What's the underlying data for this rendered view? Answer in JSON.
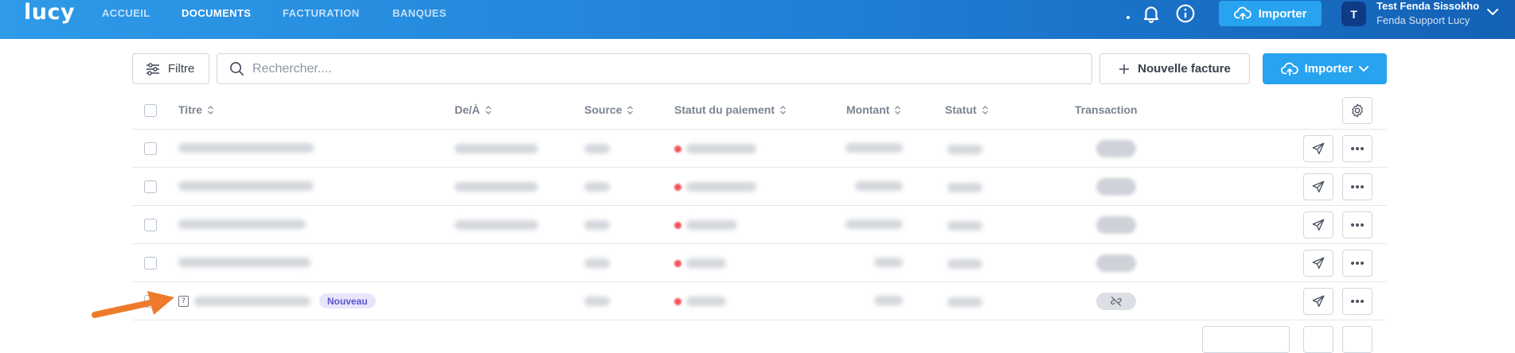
{
  "app": {
    "logo": "lucy"
  },
  "nav": {
    "items": [
      {
        "label": "ACCUEIL",
        "active": false
      },
      {
        "label": "DOCUMENTS",
        "active": true
      },
      {
        "label": "FACTURATION",
        "active": false
      },
      {
        "label": "BANQUES",
        "active": false
      }
    ]
  },
  "header": {
    "import_label": "Importer",
    "user": {
      "initial": "T",
      "name": "Test Fenda Sissokho",
      "org": "Fenda Support Lucy"
    }
  },
  "toolbar": {
    "filter_label": "Filtre",
    "search_placeholder": "Rechercher....",
    "new_invoice_label": "Nouvelle facture",
    "import_label": "Importer"
  },
  "table": {
    "columns": [
      "Titre",
      "De/À",
      "Source",
      "Statut du paiement",
      "Montant",
      "Statut",
      "Transaction"
    ],
    "new_badge": "Nouveau",
    "rows": [
      {
        "title": "",
        "from_to": "",
        "source": "",
        "payment_status": "",
        "amount": "",
        "status": "",
        "transaction": ""
      },
      {
        "title": "",
        "from_to": "",
        "source": "",
        "payment_status": "",
        "amount": "",
        "status": "",
        "transaction": ""
      },
      {
        "title": "",
        "from_to": "",
        "source": "",
        "payment_status": "",
        "amount": "",
        "status": "",
        "transaction": ""
      },
      {
        "title": "",
        "from_to": "",
        "source": "",
        "payment_status": "",
        "amount": "",
        "status": "",
        "transaction": ""
      },
      {
        "title": "",
        "from_to": "",
        "source": "",
        "payment_status": "",
        "amount": "",
        "status": "",
        "transaction": "",
        "is_new": true
      }
    ]
  },
  "colors": {
    "header_start": "#2e9ae8",
    "header_end": "#1461b5",
    "primary_button": "#27a3f0",
    "badge_bg": "#e7e6fb",
    "badge_text": "#5b55cf",
    "status_dot": "#f2545b",
    "annotation_arrow": "#ee7a2b"
  },
  "icons": {
    "bell": "bell-icon",
    "info": "info-icon",
    "upload": "cloud-upload-icon",
    "filter": "sliders-icon",
    "search": "search-icon",
    "plus": "plus-icon",
    "settings": "gear-icon",
    "send": "send-icon",
    "more": "ellipsis-icon",
    "unlink": "unlink-icon",
    "arrow": "arrow-annotation"
  }
}
